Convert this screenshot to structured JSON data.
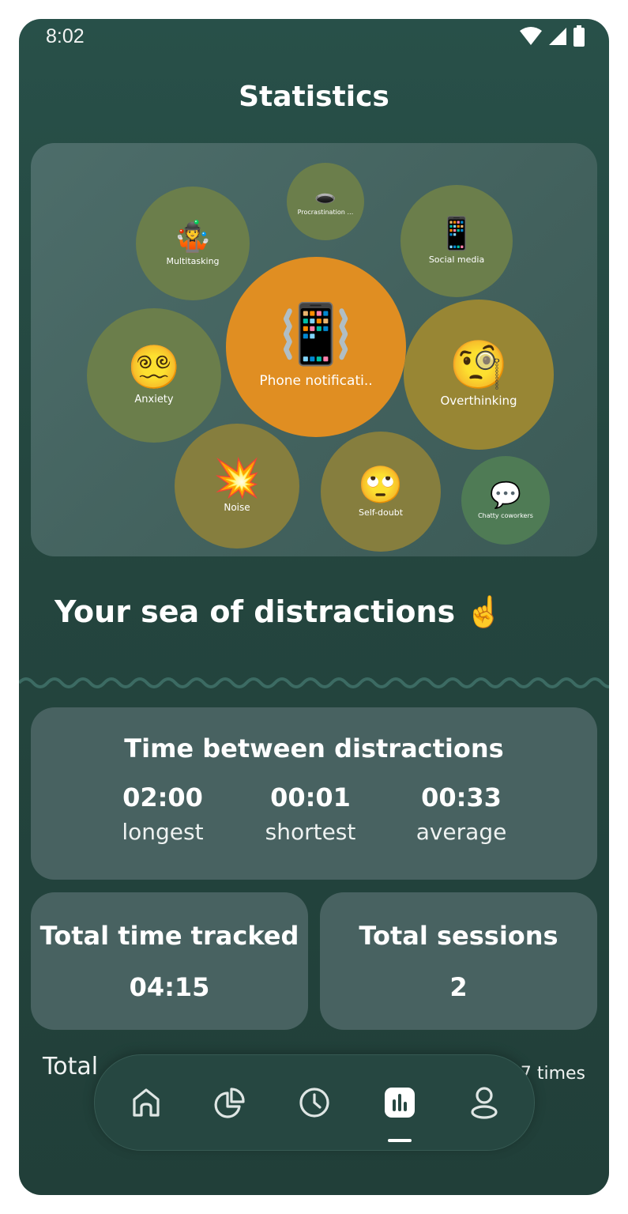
{
  "status_bar": {
    "time": "8:02"
  },
  "header": {
    "title": "Statistics"
  },
  "bubbles": [
    {
      "emoji": "🕳️",
      "label": "Procrastination …"
    },
    {
      "emoji": "🤹",
      "label": "Multitasking"
    },
    {
      "emoji": "📱",
      "label": "Social media"
    },
    {
      "emoji": "📳",
      "label": "Phone notificati.."
    },
    {
      "emoji": "😵‍💫",
      "label": "Anxiety"
    },
    {
      "emoji": "🧐",
      "label": "Overthinking"
    },
    {
      "emoji": "💥",
      "label": "Noise"
    },
    {
      "emoji": "🙄",
      "label": "Self-doubt"
    },
    {
      "emoji": "💬",
      "label": "Chatty coworkers"
    }
  ],
  "sea": {
    "title": "Your sea of distractions ☝️"
  },
  "time_between": {
    "title": "Time between distractions",
    "stats": [
      {
        "value": "02:00",
        "label": "longest"
      },
      {
        "value": "00:01",
        "label": "shortest"
      },
      {
        "value": "00:33",
        "label": "average"
      }
    ]
  },
  "total_time": {
    "title": "Total time tracked",
    "value": "04:15"
  },
  "total_sessions": {
    "title": "Total sessions",
    "value": "2"
  },
  "total_row": {
    "left_text": "Total",
    "right_text": "7 times"
  },
  "nav": {
    "items": [
      "home",
      "pie-chart",
      "clock",
      "statistics",
      "profile"
    ],
    "active": "statistics"
  },
  "colors": {
    "background": "#24463f",
    "card": "#486261",
    "bubble_olive": "#6c7f4b",
    "bubble_orange": "#e08e22",
    "bubble_gold": "#988634"
  }
}
